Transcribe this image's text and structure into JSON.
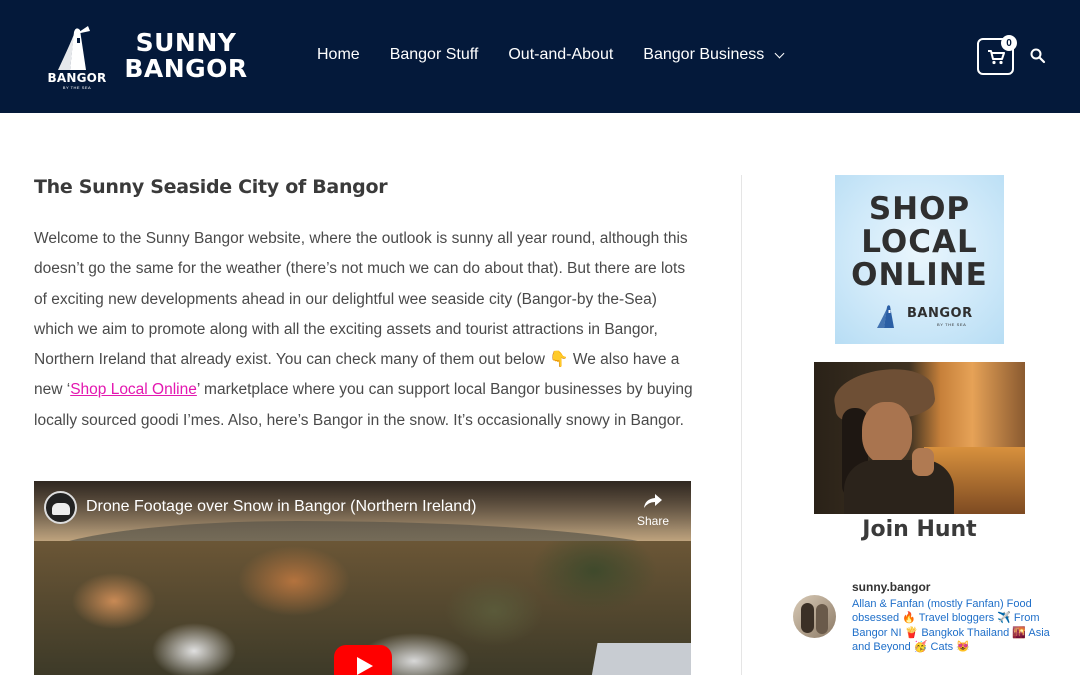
{
  "header": {
    "logo_text": "BANGOR",
    "logo_sub": "BY THE SEA",
    "site_title_line1": "SUNNY",
    "site_title_line2": "BANGOR",
    "nav": [
      {
        "label": "Home"
      },
      {
        "label": "Bangor Stuff"
      },
      {
        "label": "Out-and-About"
      },
      {
        "label": "Bangor Business",
        "has_dropdown": true
      }
    ],
    "cart_count": "0",
    "icons": {
      "cart": "cart-icon",
      "search": "search-icon",
      "dropdown": "chevron-down-icon"
    }
  },
  "main": {
    "title": "The Sunny Seaside City of Bangor",
    "intro_part1": "Welcome to the Sunny Bangor website, where the outlook is sunny all year round, although this doesn’t go the same for the weather (there’s not much we can do about that). But there are lots of exciting new developments ahead in our delightful wee seaside city (Bangor-by the-Sea) which we aim to promote along with all the exciting assets and tourist attractions in Bangor, Northern Ireland that already exist. You can check many of them out below",
    "intro_emoji": "👇",
    "intro_part2": " We also have a new ‘",
    "intro_link": "Shop Local Online",
    "intro_part3": "’ marketplace where you can support local Bangor businesses by buying locally sourced goodi I’mes. Also, here’s Bangor in the snow. It’s occasionally snowy in Bangor.",
    "video": {
      "title": "Drone Footage over Snow in Bangor (Northern Ireland)",
      "share_label": "Share"
    }
  },
  "sidebar": {
    "shop_ad": {
      "line1": "SHOP",
      "line2": "LOCAL",
      "line3": "ONLINE",
      "brand": "BANGOR",
      "brand_sub": "BY THE SEA"
    },
    "hunt_title": "Join Hunt",
    "instagram": {
      "username": "sunny.bangor",
      "bio": "Allan & Fanfan (mostly Fanfan) Food obsessed 🔥 Travel bloggers ✈️ From Bangor NI 🍟 Bangkok Thailand 🌇 Asia and Beyond 🥳 Cats 😻"
    }
  },
  "colors": {
    "header_bg": "#04193a",
    "link": "#e318b0",
    "insta_bio": "#1f6fc9"
  }
}
